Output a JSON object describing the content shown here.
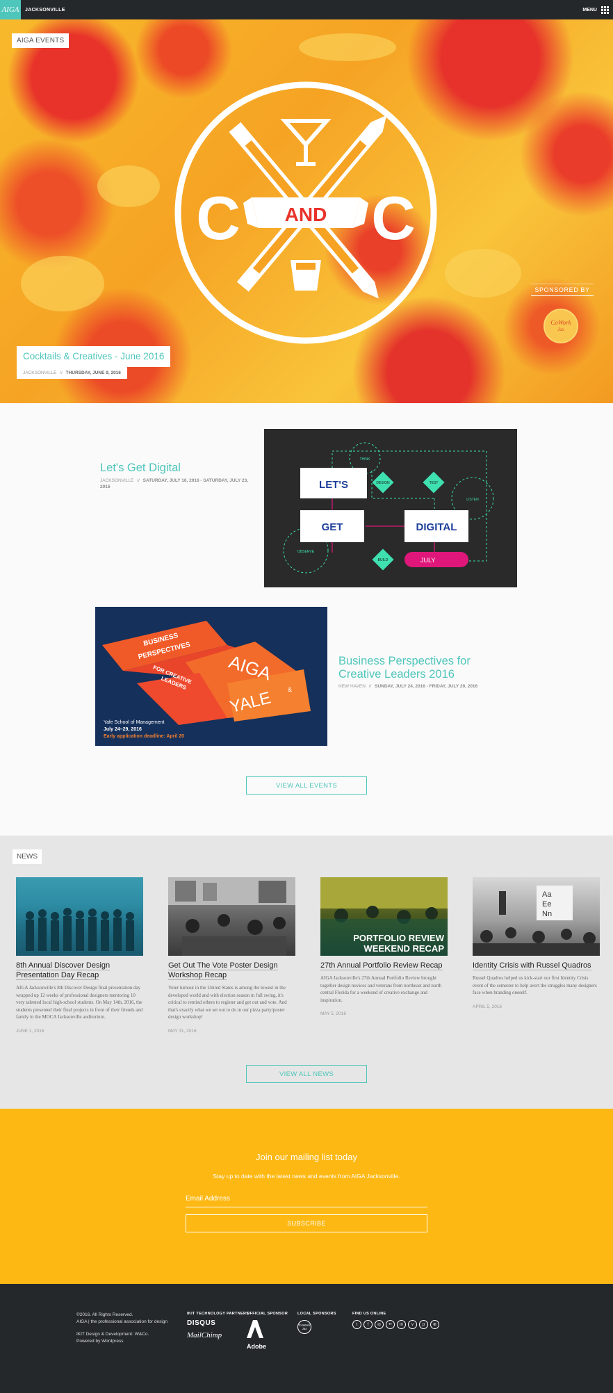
{
  "header": {
    "logo_text": "AIGA",
    "chapter": "JACKSONVILLE",
    "menu_label": "MENU"
  },
  "hero": {
    "tag": "AIGA EVENTS",
    "emblem": {
      "left": "C",
      "middle": "AND",
      "right": "C"
    },
    "title": "Cocktails & Creatives - June 2016",
    "location": "JACKSONVILLE",
    "separator": "//",
    "date": "THURSDAY, JUNE 9, 2016",
    "sponsor_label": "SPONSORED BY",
    "sponsor_logo": {
      "line1": "CoWork",
      "line2": "Jax"
    }
  },
  "events": [
    {
      "title": "Let's Get Digital",
      "location": "JACKSONVILLE",
      "separator": "//",
      "date": "SATURDAY, JULY 16, 2016 - SATURDAY, JULY 23, 2016",
      "graphic": {
        "words": [
          "LET'S",
          "GET",
          "DIGITAL"
        ],
        "diamonds": [
          "DESIGN",
          "TEST",
          "BUILD"
        ],
        "circles": [
          "THINK",
          "LISTEN",
          "OBSERVE"
        ],
        "pill": "JULY"
      }
    },
    {
      "title": "Business Perspectives for Creative Leaders 2016",
      "title_line1": "Business Perspectives for",
      "title_line2": "Creative Leaders 2016",
      "location": "NEW HAVEN",
      "separator": "//",
      "date": "SUNDAY, JULY 24, 2016 - FRIDAY, JULY 29, 2016",
      "graphic": {
        "band1": "BUSINESS",
        "band2": "PERSPECTIVES",
        "band3": "FOR CREATIVE",
        "band4": "LEADERS",
        "aiga": "AIGA",
        "amp": "&",
        "yale": "YALE",
        "school": "Yale School of Management",
        "dates": "July 24–29, 2016",
        "deadline": "Early application deadline: April 20"
      }
    }
  ],
  "view_all_events": "VIEW ALL EVENTS",
  "news": {
    "tag": "NEWS",
    "items": [
      {
        "title": "8th Annual Discover Design Presentation Day Recap",
        "excerpt": "AIGA Jacksonville's 8th Discover Design final presentation day wrapped up 12 weeks of professional designers mentoring 10 very talented local high-school students. On May 14th, 2016, the students presented their final projects in front of their friends and family in the MOCA Jacksonville auditorium.",
        "date": "JUNE 1, 2016"
      },
      {
        "title": "Get Out The Vote Poster Design Workshop Recap",
        "excerpt": "Voter turnout in the United States is among the lowest in the developed world and with election season in full swing, it's critical to remind others to register and get out and vote. And that's exactly what we set out to do in our pizza party/poster design workshop!",
        "date": "MAY 31, 2016"
      },
      {
        "title": "27th Annual Portfolio Review Recap",
        "excerpt": "AIGA Jacksonville's 27th Annual Portfolio Review brought together design novices and veterans from northeast and north central Florida for a weekend of creative exchange and inspiration.",
        "date": "MAY 5, 2016",
        "thumb_text_1": "PORTFOLIO REVIEW",
        "thumb_text_2": "WEEKEND RECAP"
      },
      {
        "title": "Identity Crisis with Russel Quadros",
        "excerpt": "Russel Quadros helped us kick-start our first Identity Crisis event of the semester to help avert the struggles many designers face when branding oneself.",
        "date": "APRIL 5, 2016",
        "thumb_glyphs": [
          "Aa",
          "Ee",
          "Nn"
        ]
      }
    ]
  },
  "view_all_news": "VIEW ALL NEWS",
  "mailing": {
    "heading": "Join our mailing list today",
    "subheading": "Stay up to date with the latest news and events from AIGA Jacksonville.",
    "email_placeholder": "Email Address",
    "subscribe_label": "SUBSCRIBE"
  },
  "footer": {
    "copyright": "©2016. All Rights Reserved.",
    "tagline": "AIGA | the professional association for design",
    "dev_credit": "IKIT Design & Development: W&Co.",
    "powered": "Powered by Wordpress",
    "tech_partners_heading": "IKIT TECHNOLOGY PARTNERS",
    "tech_partners": [
      "DISQUS",
      "MailChimp"
    ],
    "official_sponsor_heading": "OFFICIAL SPONSOR",
    "official_sponsor": "Adobe",
    "local_sponsors_heading": "LOCAL SPONSORS",
    "local_sponsor": "CoWork Jax",
    "find_us_heading": "FIND US ONLINE",
    "social_icons": [
      "twitter-icon",
      "facebook-icon",
      "instagram-icon",
      "flickr-icon",
      "linkedin-icon",
      "vimeo-icon",
      "pinterest-icon",
      "dribbble-icon"
    ]
  },
  "colors": {
    "accent": "#4fc6bb",
    "dark": "#24282b",
    "mailing_bg": "#fdb813",
    "news_bg": "#e6e6e6",
    "hero_orange": "#f6a324",
    "hero_red": "#e8332a",
    "digital_blue": "#1d3f9c",
    "digital_green": "#3ee0b0",
    "digital_pink": "#e0177b"
  }
}
